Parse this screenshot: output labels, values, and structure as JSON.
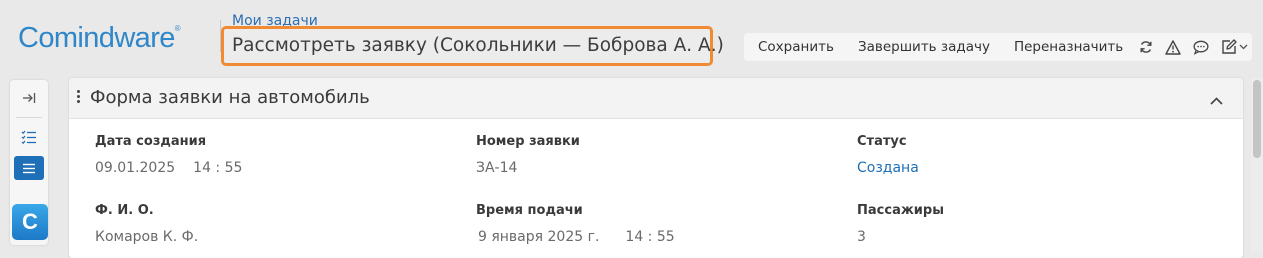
{
  "brand": {
    "logo_text": "Comindware",
    "registered_mark": "®",
    "accent": "#2f86c8"
  },
  "header": {
    "breadcrumb": "Мои задачи",
    "title": "Рассмотреть заявку (Сокольники — Боброва А. А.)",
    "highlight_color": "#f08a33"
  },
  "toolbar": {
    "save_label": "Сохранить",
    "complete_label": "Завершить задачу",
    "reassign_label": "Переназначить",
    "icons": [
      "refresh-icon",
      "warning-icon",
      "comment-icon",
      "edit-icon",
      "chevron-down-icon"
    ]
  },
  "rail": {
    "icons": [
      "collapse-right-icon",
      "task-list-icon",
      "form-list-icon",
      "app-icon"
    ],
    "app_letter": "C",
    "active_color": "#1e6fb8"
  },
  "form": {
    "title": "Форма заявки на автомобиль",
    "fields": {
      "created_date": {
        "label": "Дата создания",
        "date": "09.01.2025",
        "time": "14 : 55"
      },
      "request_number": {
        "label": "Номер заявки",
        "value": "ЗА-14"
      },
      "status": {
        "label": "Статус",
        "value": "Создана"
      },
      "full_name": {
        "label": "Ф. И. О.",
        "value": "Комаров К. Ф."
      },
      "submit_time": {
        "label": "Время подачи",
        "date": "9 января 2025 г.",
        "time": "14 : 55"
      },
      "passengers": {
        "label": "Пассажиры",
        "value": "3"
      }
    }
  }
}
